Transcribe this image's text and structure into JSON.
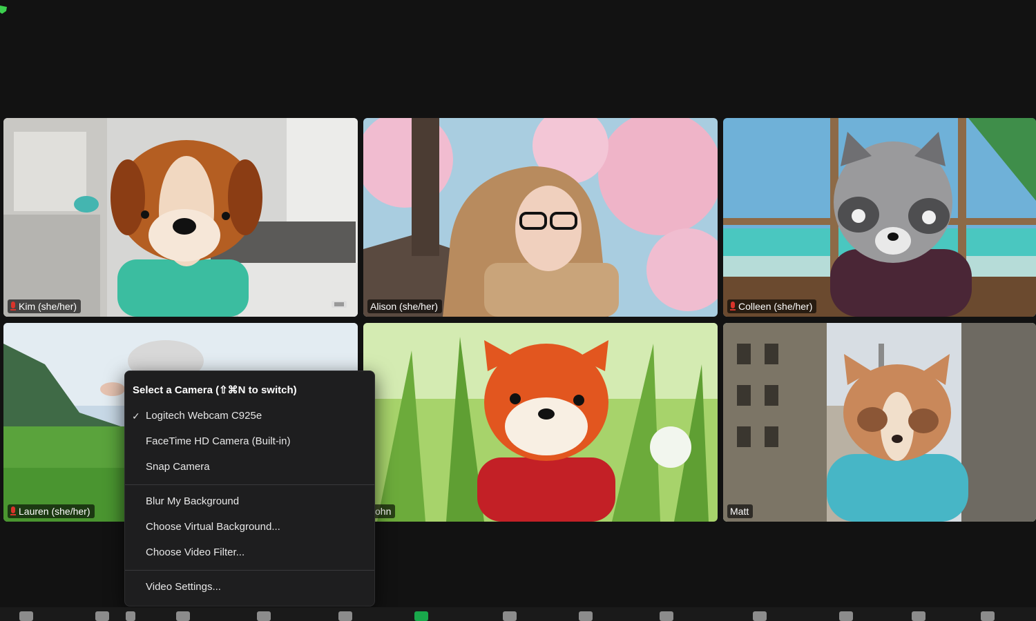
{
  "tiles": [
    {
      "name": "Kim (she/her)",
      "muted": true,
      "active": false
    },
    {
      "name": "Alison (she/her)",
      "muted": false,
      "active": false
    },
    {
      "name": "Colleen (she/her)",
      "muted": true,
      "active": false
    },
    {
      "name": "Lauren (she/her)",
      "muted": true,
      "active": false
    },
    {
      "name": "John",
      "muted": false,
      "active": false
    },
    {
      "name": "Matt",
      "muted": false,
      "active": true
    }
  ],
  "camera_menu": {
    "header": "Select a Camera (⇧⌘N to switch)",
    "items": [
      {
        "label": "Logitech Webcam C925e",
        "checked": true
      },
      {
        "label": "FaceTime HD Camera (Built-in)",
        "checked": false
      },
      {
        "label": "Snap Camera",
        "checked": false
      }
    ],
    "options": [
      {
        "label": "Blur My Background"
      },
      {
        "label": "Choose Virtual Background..."
      },
      {
        "label": "Choose Video Filter..."
      }
    ],
    "settings": {
      "label": "Video Settings..."
    }
  },
  "colors": {
    "active_border": "#4fbf4f",
    "muted_mic": "#d9342b",
    "background": "#121212"
  },
  "icons": [
    "mic-off-icon",
    "checkmark-icon",
    "pin-icon",
    "security-shield-icon"
  ]
}
